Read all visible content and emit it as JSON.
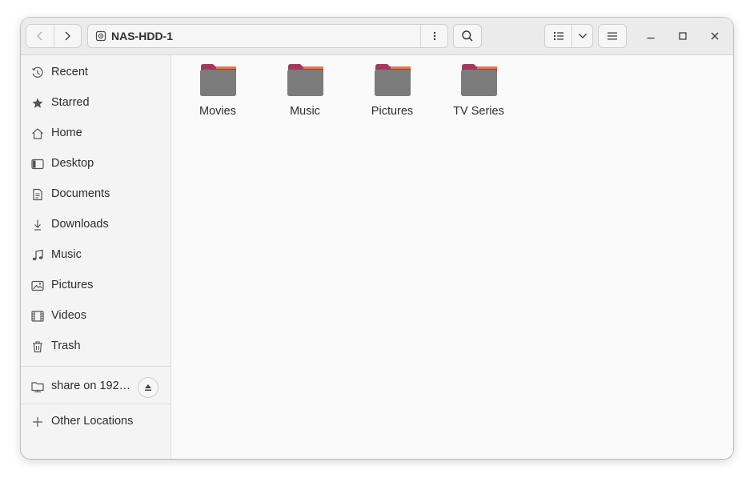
{
  "window": {
    "location_name": "NAS-HDD-1"
  },
  "toolbar": {
    "back_icon": "chevron-left-icon",
    "forward_icon": "chevron-right-icon",
    "location_icon": "network-drive-icon",
    "path_menu_icon": "vertical-dots-icon",
    "search_icon": "search-icon",
    "view_icon": "list-view-icon",
    "view_options_icon": "chevron-down-icon",
    "main_menu_icon": "hamburger-menu-icon",
    "minimize_icon": "minimize-icon",
    "maximize_icon": "maximize-icon",
    "close_icon": "close-icon"
  },
  "sidebar": {
    "items": [
      {
        "label": "Recent",
        "icon": "clock-icon"
      },
      {
        "label": "Starred",
        "icon": "star-icon"
      },
      {
        "label": "Home",
        "icon": "home-icon"
      },
      {
        "label": "Desktop",
        "icon": "desktop-icon"
      },
      {
        "label": "Documents",
        "icon": "document-icon"
      },
      {
        "label": "Downloads",
        "icon": "download-icon"
      },
      {
        "label": "Music",
        "icon": "music-note-icon"
      },
      {
        "label": "Pictures",
        "icon": "image-icon"
      },
      {
        "label": "Videos",
        "icon": "film-icon"
      },
      {
        "label": "Trash",
        "icon": "trash-icon"
      }
    ],
    "mounts": [
      {
        "label": "share on 192…",
        "icon": "network-folder-icon",
        "action_icon": "eject-icon"
      }
    ],
    "other_locations": {
      "label": "Other Locations",
      "icon": "plus-icon"
    }
  },
  "content": {
    "folders": [
      {
        "label": "Movies"
      },
      {
        "label": "Music"
      },
      {
        "label": "Pictures"
      },
      {
        "label": "TV Series"
      }
    ]
  },
  "colors": {
    "folder_body": "#7b7b7b",
    "folder_tab": "#a3385f",
    "folder_accent": "#e8774d",
    "headerbar_bg": "#ebebeb",
    "sidebar_bg": "#f4f4f4",
    "content_bg": "#fafafa"
  }
}
